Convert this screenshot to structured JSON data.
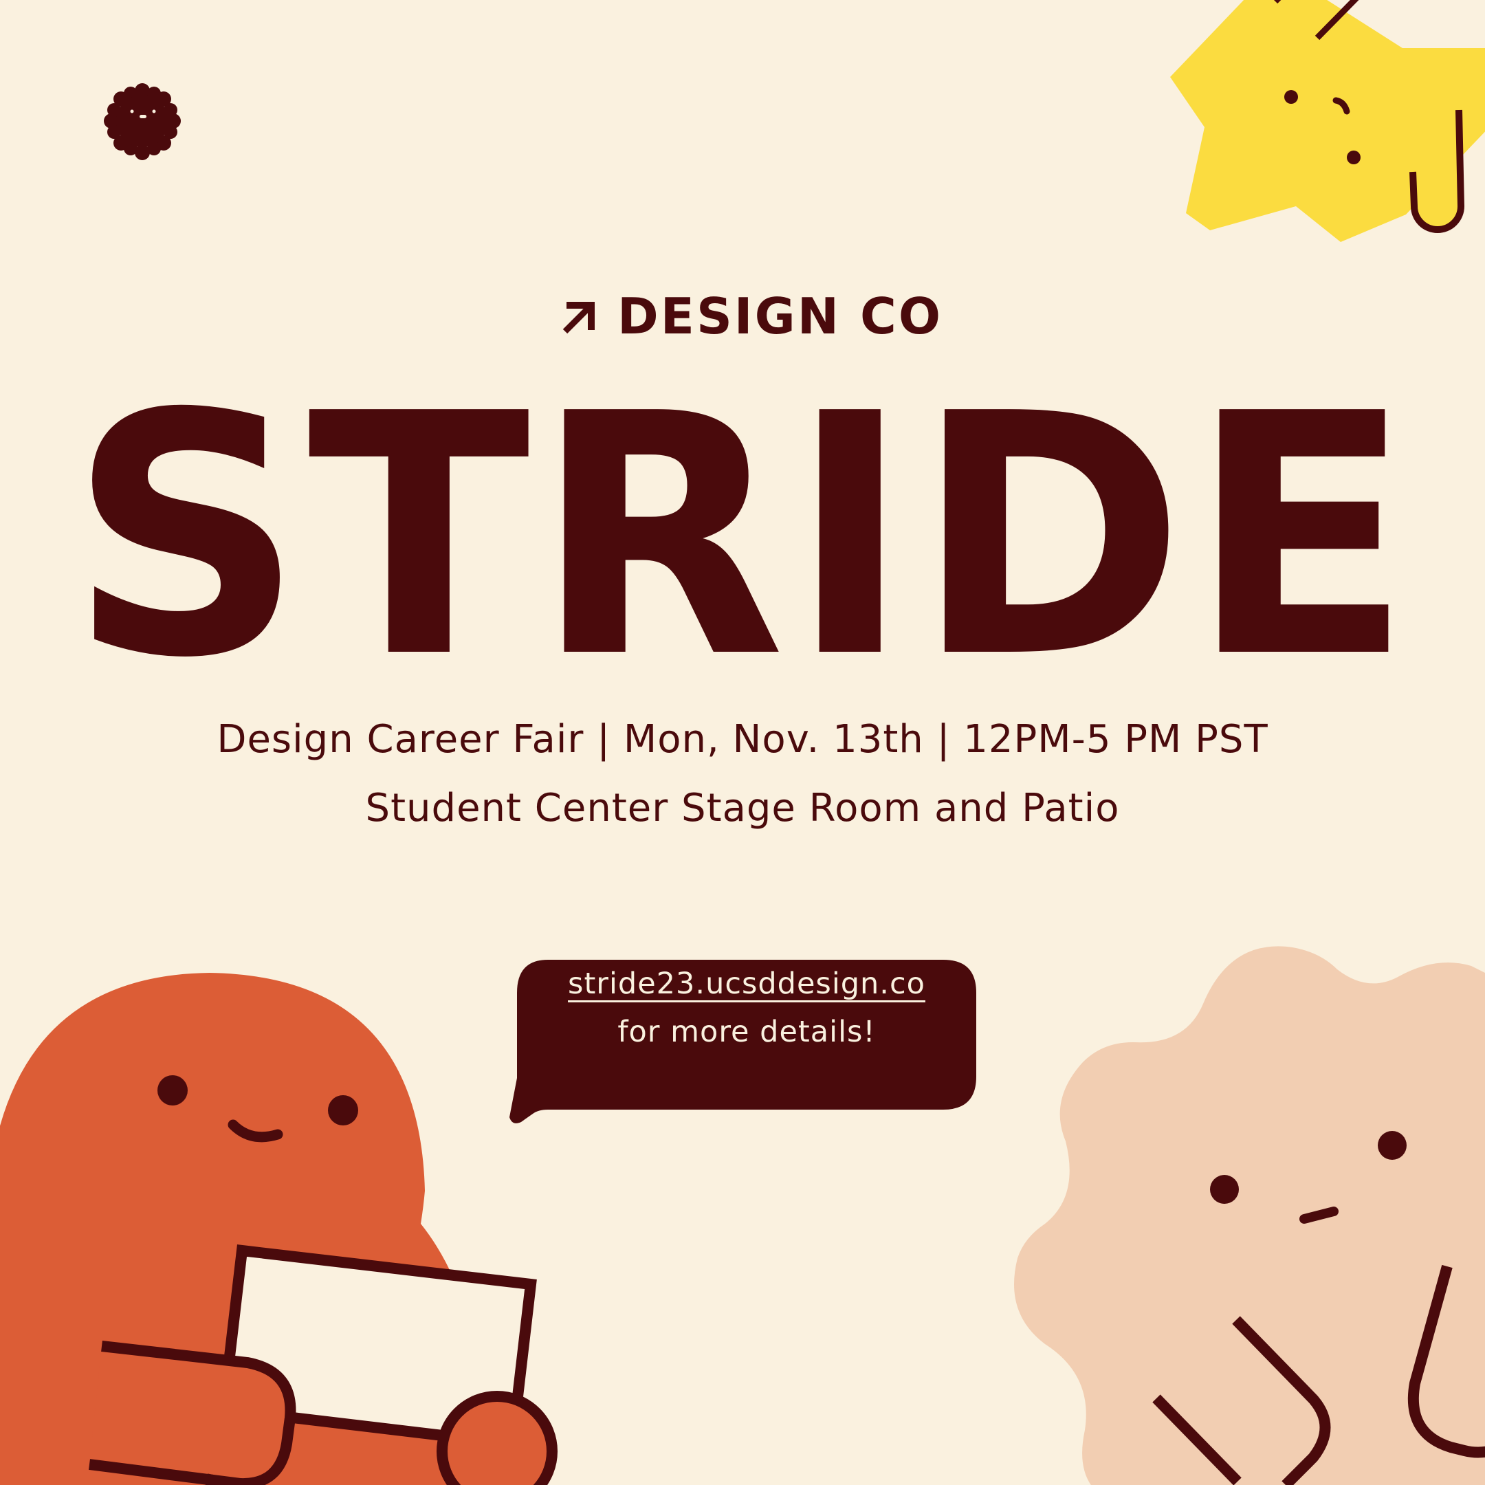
{
  "brand": {
    "name": "DESIGN CO",
    "icon": "arrow-up-right-icon",
    "corner_icon": "flower-face-icon"
  },
  "event": {
    "title": "STRIDE",
    "line1": "Design Career Fair | Mon, Nov. 13th | 12PM-5 PM PST",
    "line2": "Student Center Stage Room and Patio"
  },
  "bubble": {
    "link": "stride23.ucsddesign.co",
    "note": "for more details!"
  },
  "colors": {
    "background": "#FAF1DF",
    "dark": "#4A0A0C",
    "orange": "#DC5D36",
    "yellow": "#FBDC40",
    "peach": "#F2CEB2"
  }
}
